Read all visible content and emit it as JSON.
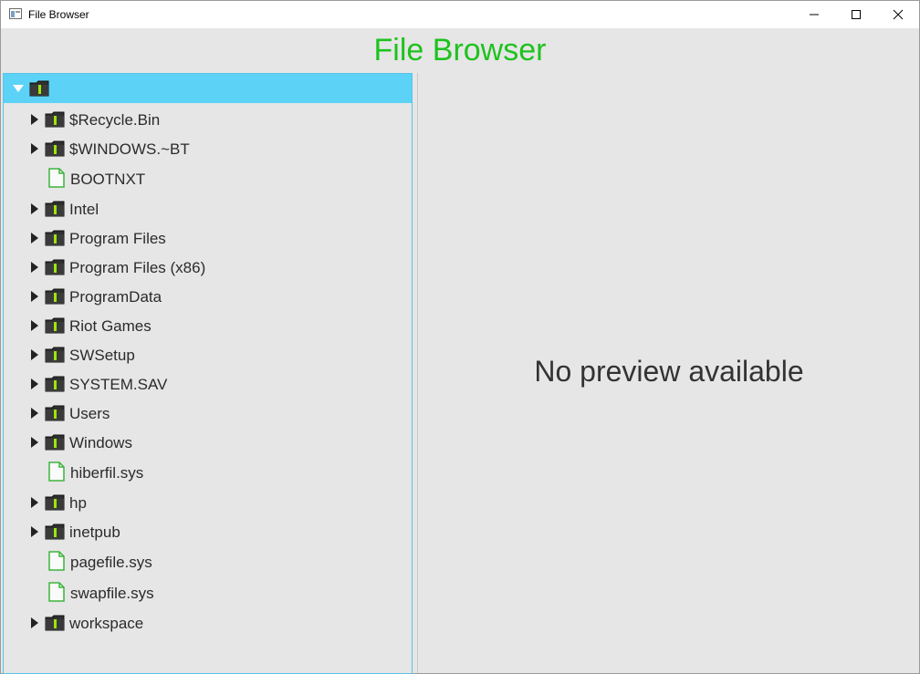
{
  "window": {
    "title": "File Browser"
  },
  "header": {
    "title": "File Browser"
  },
  "preview": {
    "message": "No preview available"
  },
  "colors": {
    "accent": "#1ec21e",
    "selection": "#5cd3f6",
    "folder": "#2f2f2f",
    "folder_mark": "#9be60a",
    "file": "#3db33d"
  },
  "tree": {
    "root": {
      "label": "",
      "icon": "folder-icon",
      "expanded": true,
      "selected": true
    },
    "items": [
      {
        "label": "$Recycle.Bin",
        "type": "folder"
      },
      {
        "label": "$WINDOWS.~BT",
        "type": "folder"
      },
      {
        "label": "BOOTNXT",
        "type": "file"
      },
      {
        "label": "Intel",
        "type": "folder"
      },
      {
        "label": "Program Files",
        "type": "folder"
      },
      {
        "label": "Program Files (x86)",
        "type": "folder"
      },
      {
        "label": "ProgramData",
        "type": "folder"
      },
      {
        "label": "Riot Games",
        "type": "folder"
      },
      {
        "label": "SWSetup",
        "type": "folder"
      },
      {
        "label": "SYSTEM.SAV",
        "type": "folder"
      },
      {
        "label": "Users",
        "type": "folder"
      },
      {
        "label": "Windows",
        "type": "folder"
      },
      {
        "label": "hiberfil.sys",
        "type": "file"
      },
      {
        "label": "hp",
        "type": "folder"
      },
      {
        "label": "inetpub",
        "type": "folder"
      },
      {
        "label": "pagefile.sys",
        "type": "file"
      },
      {
        "label": "swapfile.sys",
        "type": "file"
      },
      {
        "label": "workspace",
        "type": "folder"
      }
    ]
  }
}
